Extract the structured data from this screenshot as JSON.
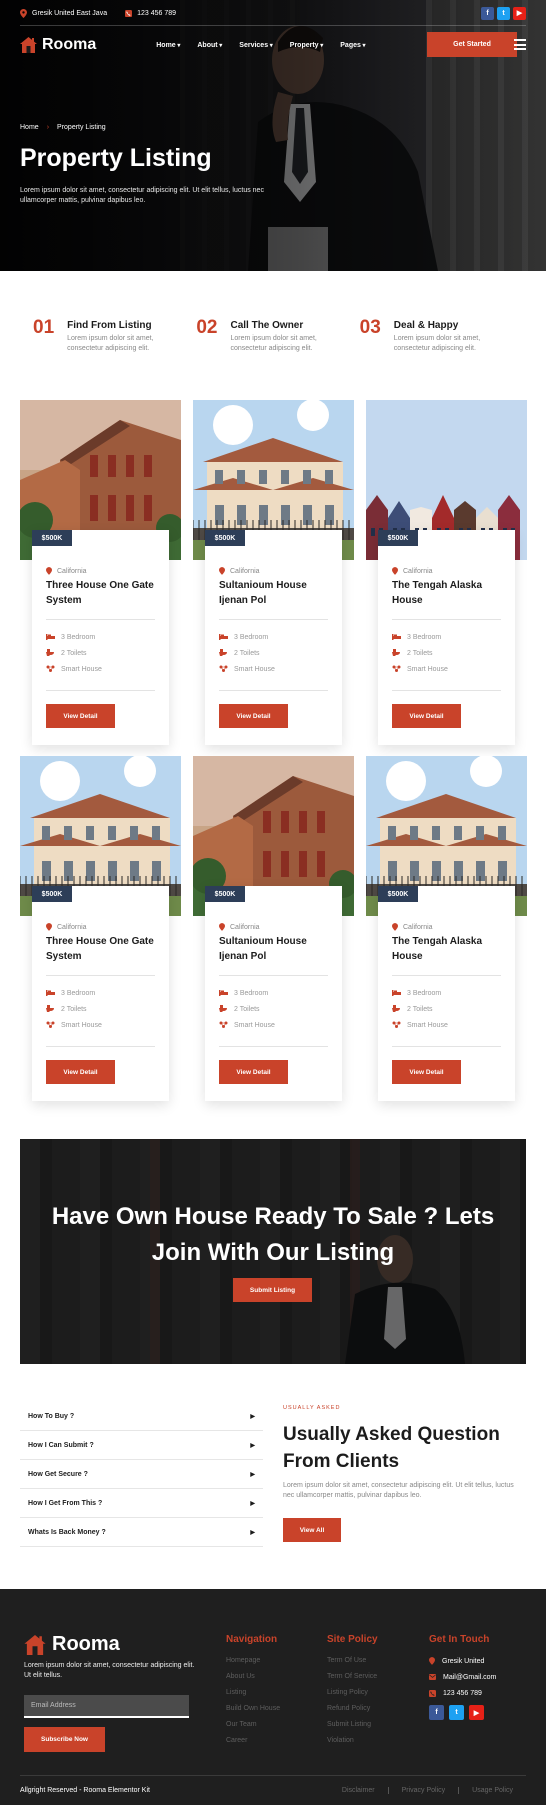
{
  "topbar": {
    "address": "Gresik United East Java",
    "phone": "123 456 789"
  },
  "brand": {
    "name": "Rooma"
  },
  "nav": {
    "items": [
      "Home",
      "About",
      "Services",
      "Property",
      "Pages"
    ],
    "cta": "Get Started"
  },
  "hero": {
    "breadcrumb": [
      "Home",
      "Property Listing"
    ],
    "title": "Property Listing",
    "desc": "Lorem ipsum dolor sit amet, consectetur adipiscing elit. Ut elit tellus, luctus nec ullamcorper mattis, pulvinar dapibus leo."
  },
  "steps": [
    {
      "num": "01",
      "title": "Find From Listing",
      "desc": "Lorem ipsum dolor sit amet, consectetur adipiscing elit."
    },
    {
      "num": "02",
      "title": "Call The Owner",
      "desc": "Lorem ipsum dolor sit amet, consectetur adipiscing elit."
    },
    {
      "num": "03",
      "title": "Deal & Happy",
      "desc": "Lorem ipsum dolor sit amet, consectetur adipiscing elit."
    }
  ],
  "listings": [
    {
      "price": "$500K",
      "location": "California",
      "title": "Three House One Gate System",
      "bedroom": "3 Bedroom",
      "toilets": "2 Toilets",
      "smart": "Smart House",
      "button": "View Detail"
    },
    {
      "price": "$500K",
      "location": "California",
      "title": "Sultanioum House Ijenan Pol",
      "bedroom": "3 Bedroom",
      "toilets": "2 Toilets",
      "smart": "Smart House",
      "button": "View Detail"
    },
    {
      "price": "$500K",
      "location": "California",
      "title": "The Tengah Alaska House",
      "bedroom": "3 Bedroom",
      "toilets": "2 Toilets",
      "smart": "Smart House",
      "button": "View Detail"
    },
    {
      "price": "$500K",
      "location": "California",
      "title": "Three House One Gate System",
      "bedroom": "3 Bedroom",
      "toilets": "2 Toilets",
      "smart": "Smart House",
      "button": "View Detail"
    },
    {
      "price": "$500K",
      "location": "California",
      "title": "Sultanioum House Ijenan Pol",
      "bedroom": "3 Bedroom",
      "toilets": "2 Toilets",
      "smart": "Smart House",
      "button": "View Detail"
    },
    {
      "price": "$500K",
      "location": "California",
      "title": "The Tengah Alaska House",
      "bedroom": "3 Bedroom",
      "toilets": "2 Toilets",
      "smart": "Smart House",
      "button": "View Detail"
    }
  ],
  "cta": {
    "line1": "Have Own House Ready To Sale ? Lets",
    "line2": "Join With Our Listing",
    "button": "Submit Listing"
  },
  "faq": {
    "questions": [
      "How To Buy ?",
      "How I Can Submit ?",
      "How Get Secure ?",
      "How I Get From This ?",
      "Whats Is Back Money ?"
    ],
    "tag": "USUALLY ASKED",
    "title": "Usually Asked Question From Clients",
    "desc": "Lorem ipsum dolor sit amet, consectetur adipiscing elit. Ut elit tellus, luctus nec ullamcorper mattis, pulvinar dapibus leo.",
    "button": "View All"
  },
  "footer": {
    "desc": "Lorem ipsum dolor sit amet, consectetur adipiscing elit. Ut elit tellus.",
    "email_placeholder": "Email Address",
    "subscribe": "Subscribe Now",
    "navigation": {
      "title": "Navigation",
      "links": [
        "Homepage",
        "About Us",
        "Listing",
        "Build Own House",
        "Our Team",
        "Career"
      ]
    },
    "policy": {
      "title": "Site Policy",
      "links": [
        "Term Of Use",
        "Term Of Service",
        "Listing Policy",
        "Refund Policy",
        "Submit Listing",
        "Violation"
      ]
    },
    "contact": {
      "title": "Get In Touch",
      "address": "Gresik United",
      "email": "Mail@Gmail.com",
      "phone": "123 456 789"
    },
    "copyright": "Allgright Reserved - Rooma Elementor Kit",
    "legal": [
      "Disclaimer",
      "Privacy Policy",
      "Usage Policy"
    ]
  },
  "colors": {
    "accent": "#c9432a",
    "price_badge": "#2d3e58",
    "footer_bg": "#1f1f1f"
  },
  "icons": [
    "map-pin-icon",
    "phone-icon",
    "facebook-icon",
    "twitter-icon",
    "youtube-icon",
    "house-logo-icon",
    "menu-icon",
    "bed-icon",
    "toilet-icon",
    "smart-house-icon",
    "email-icon"
  ]
}
